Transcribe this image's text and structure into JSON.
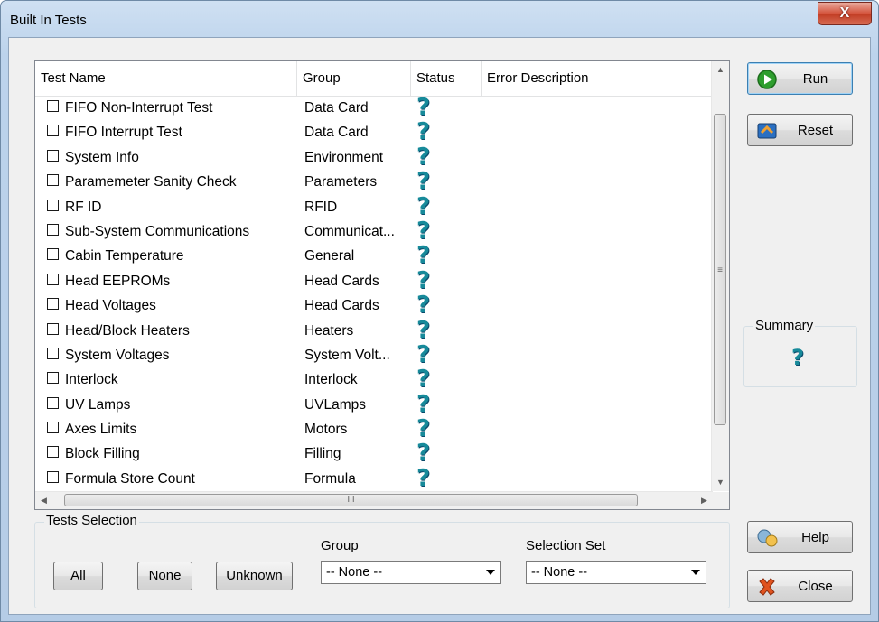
{
  "window": {
    "title": "Built In Tests",
    "close_glyph": "X"
  },
  "list": {
    "columns": [
      "Test Name",
      "Group",
      "Status",
      "Error Description"
    ],
    "status_glyph": "?",
    "rows": [
      {
        "name": "FIFO Non-Interrupt Test",
        "group": "Data Card"
      },
      {
        "name": "FIFO Interrupt Test",
        "group": "Data Card"
      },
      {
        "name": "System Info",
        "group": "Environment"
      },
      {
        "name": "Paramemeter Sanity Check",
        "group": "Parameters"
      },
      {
        "name": "RF ID",
        "group": "RFID"
      },
      {
        "name": "Sub-System Communications",
        "group": "Communicat..."
      },
      {
        "name": "Cabin Temperature",
        "group": "General"
      },
      {
        "name": "Head EEPROMs",
        "group": "Head Cards"
      },
      {
        "name": "Head Voltages",
        "group": "Head Cards"
      },
      {
        "name": "Head/Block Heaters",
        "group": "Heaters"
      },
      {
        "name": "System Voltages",
        "group": "System Volt..."
      },
      {
        "name": "Interlock",
        "group": "Interlock"
      },
      {
        "name": "UV Lamps",
        "group": "UVLamps"
      },
      {
        "name": "Axes Limits",
        "group": "Motors"
      },
      {
        "name": "Block Filling",
        "group": "Filling"
      },
      {
        "name": "Formula Store Count",
        "group": "Formula"
      }
    ],
    "scroll_grip": "≡",
    "hscroll_grip": "III"
  },
  "buttons": {
    "run": "Run",
    "reset": "Reset",
    "help": "Help",
    "close": "Close",
    "all": "All",
    "none": "None",
    "unknown": "Unknown"
  },
  "summary": {
    "label": "Summary",
    "value": "?"
  },
  "selection": {
    "label": "Tests Selection",
    "group_label": "Group",
    "group_value": "-- None --",
    "set_label": "Selection Set",
    "set_value": "-- None --"
  }
}
